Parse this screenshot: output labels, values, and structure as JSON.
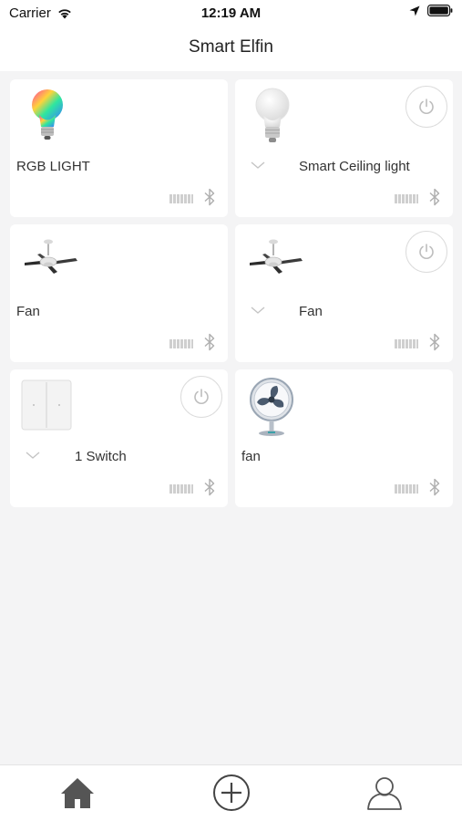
{
  "status_bar": {
    "carrier": "Carrier",
    "time": "12:19 AM"
  },
  "header": {
    "title": "Smart Elfin"
  },
  "devices": [
    {
      "name": "RGB LIGHT",
      "image": "rgb-bulb-icon",
      "has_power_button": false,
      "has_chevron": false
    },
    {
      "name": "Smart Ceiling light",
      "image": "white-bulb-icon",
      "has_power_button": true,
      "has_chevron": true
    },
    {
      "name": "Fan",
      "image": "ceiling-fan-icon",
      "has_power_button": false,
      "has_chevron": false
    },
    {
      "name": "Fan",
      "image": "ceiling-fan-icon",
      "has_power_button": true,
      "has_chevron": true
    },
    {
      "name": "1 Switch",
      "image": "wall-switch-icon",
      "has_power_button": true,
      "has_chevron": true
    },
    {
      "name": "fan",
      "image": "desk-fan-icon",
      "has_power_button": false,
      "has_chevron": false
    }
  ],
  "tab_bar": {
    "items": [
      "home-icon",
      "add-icon",
      "profile-icon"
    ]
  },
  "colors": {
    "background": "#f4f4f5",
    "card": "#ffffff",
    "icon_gray": "#b5b5b5",
    "home_active": "#555555"
  }
}
